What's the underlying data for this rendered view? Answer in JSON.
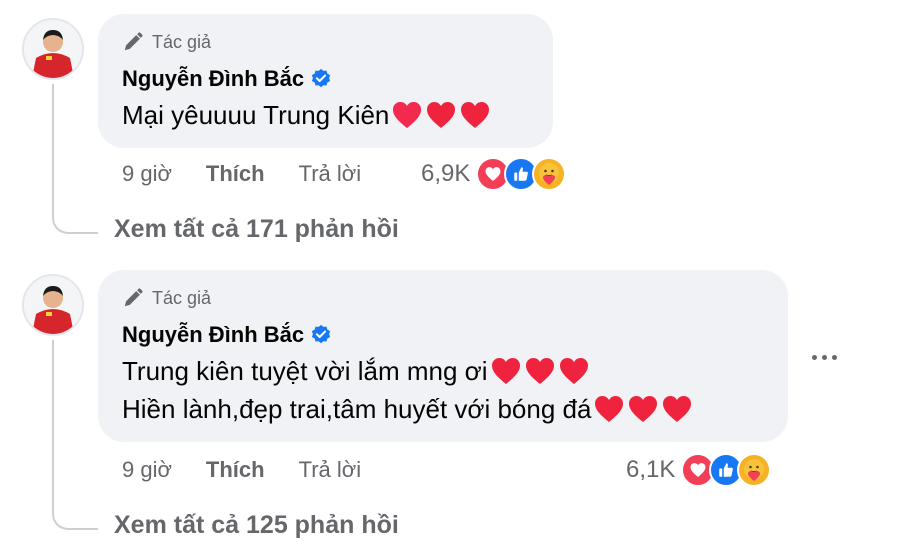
{
  "comments": [
    {
      "author_badge": "Tác giả",
      "name": "Nguyễn Đình Bắc",
      "lines": [
        "Mại yêuuuu Trung Kiên"
      ],
      "time": "9 giờ",
      "like_label": "Thích",
      "reply_label": "Trả lời",
      "reaction_count": "6,9K",
      "view_replies": "Xem tất cả 171 phản hồi"
    },
    {
      "author_badge": "Tác giả",
      "name": "Nguyễn Đình Bắc",
      "lines": [
        "Trung kiên tuyệt vời lắm mng ơi",
        "Hiền lành,đẹp trai,tâm huyết với bóng đá"
      ],
      "time": "9 giờ",
      "like_label": "Thích",
      "reply_label": "Trả lời",
      "reaction_count": "6,1K",
      "view_replies": "Xem tất cả 125 phản hồi"
    }
  ],
  "icons": {
    "author": "pen-icon",
    "verified": "verified-badge-icon",
    "emoji": "red-heart-icon",
    "reactions": [
      "love-reaction-icon",
      "like-reaction-icon",
      "care-reaction-icon"
    ],
    "more": "more-options-icon"
  },
  "colors": {
    "bubble": "#f0f2f5",
    "secondary_text": "#65676b",
    "verified": "#1877f2",
    "love": "#f33e58",
    "like": "#1877f2",
    "heart_emoji": "#e0245e"
  }
}
